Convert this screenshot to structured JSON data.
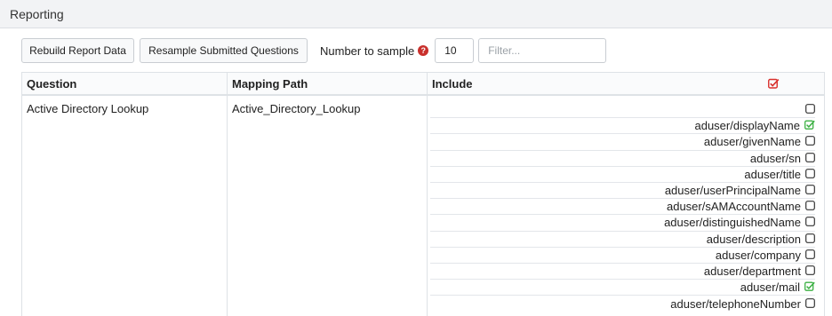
{
  "header": {
    "title": "Reporting"
  },
  "toolbar": {
    "rebuild_label": "Rebuild Report Data",
    "resample_label": "Resample Submitted Questions",
    "sample_label": "Number to sample",
    "sample_value": "10",
    "filter_placeholder": "Filter..."
  },
  "table": {
    "columns": [
      "Question",
      "Mapping Path",
      "Include"
    ],
    "row": {
      "question": "Active Directory Lookup",
      "mapping_path": "Active_Directory_Lookup",
      "includes": [
        {
          "label": "",
          "checked": false
        },
        {
          "label": "aduser/displayName",
          "checked": true
        },
        {
          "label": "aduser/givenName",
          "checked": false
        },
        {
          "label": "aduser/sn",
          "checked": false
        },
        {
          "label": "aduser/title",
          "checked": false
        },
        {
          "label": "aduser/userPrincipalName",
          "checked": false
        },
        {
          "label": "aduser/sAMAccountName",
          "checked": false
        },
        {
          "label": "aduser/distinguishedName",
          "checked": false
        },
        {
          "label": "aduser/description",
          "checked": false
        },
        {
          "label": "aduser/company",
          "checked": false
        },
        {
          "label": "aduser/department",
          "checked": false
        },
        {
          "label": "aduser/mail",
          "checked": true
        },
        {
          "label": "aduser/telephoneNumber",
          "checked": false
        }
      ]
    }
  },
  "colors": {
    "checked": "#3cb043",
    "header_check": "#d9302c",
    "help": "#c9302c"
  },
  "icons": {
    "checked": "checked-square-icon",
    "unchecked": "empty-square-icon",
    "help": "question-circle-icon"
  }
}
